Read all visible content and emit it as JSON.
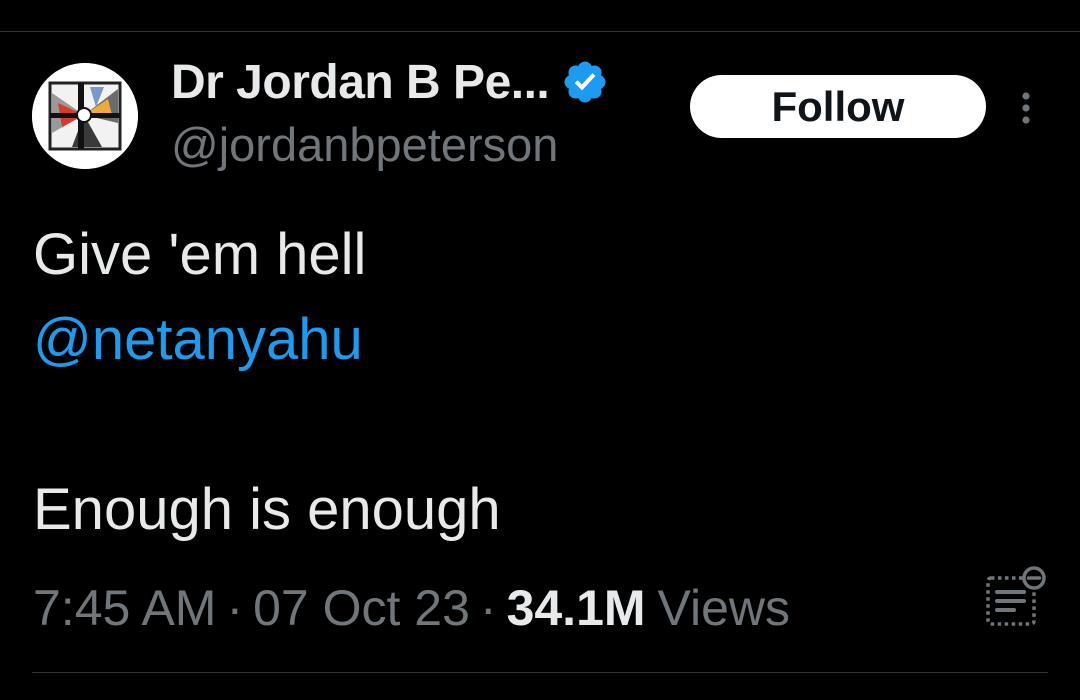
{
  "author": {
    "display_name": "Dr Jordan B Pe...",
    "handle": "@jordanbpeterson",
    "verified_color": "#1d9bf0"
  },
  "follow_button": {
    "label": "Follow"
  },
  "tweet": {
    "line1": "Give 'em hell",
    "mention": "@netanyahu",
    "line3": "Enough is enough"
  },
  "meta": {
    "time": "7:45 AM",
    "separator": "·",
    "date": "07 Oct 23",
    "views_count": "34.1M",
    "views_label": "Views"
  },
  "icons": {
    "verified": "verified-badge-icon",
    "more": "more-options-icon",
    "analytics": "post-analytics-icon"
  },
  "colors": {
    "background": "#000000",
    "text": "#e7e9ea",
    "secondary_text": "#71767b",
    "link": "#1d9bf0",
    "follow_bg": "#ffffff"
  }
}
